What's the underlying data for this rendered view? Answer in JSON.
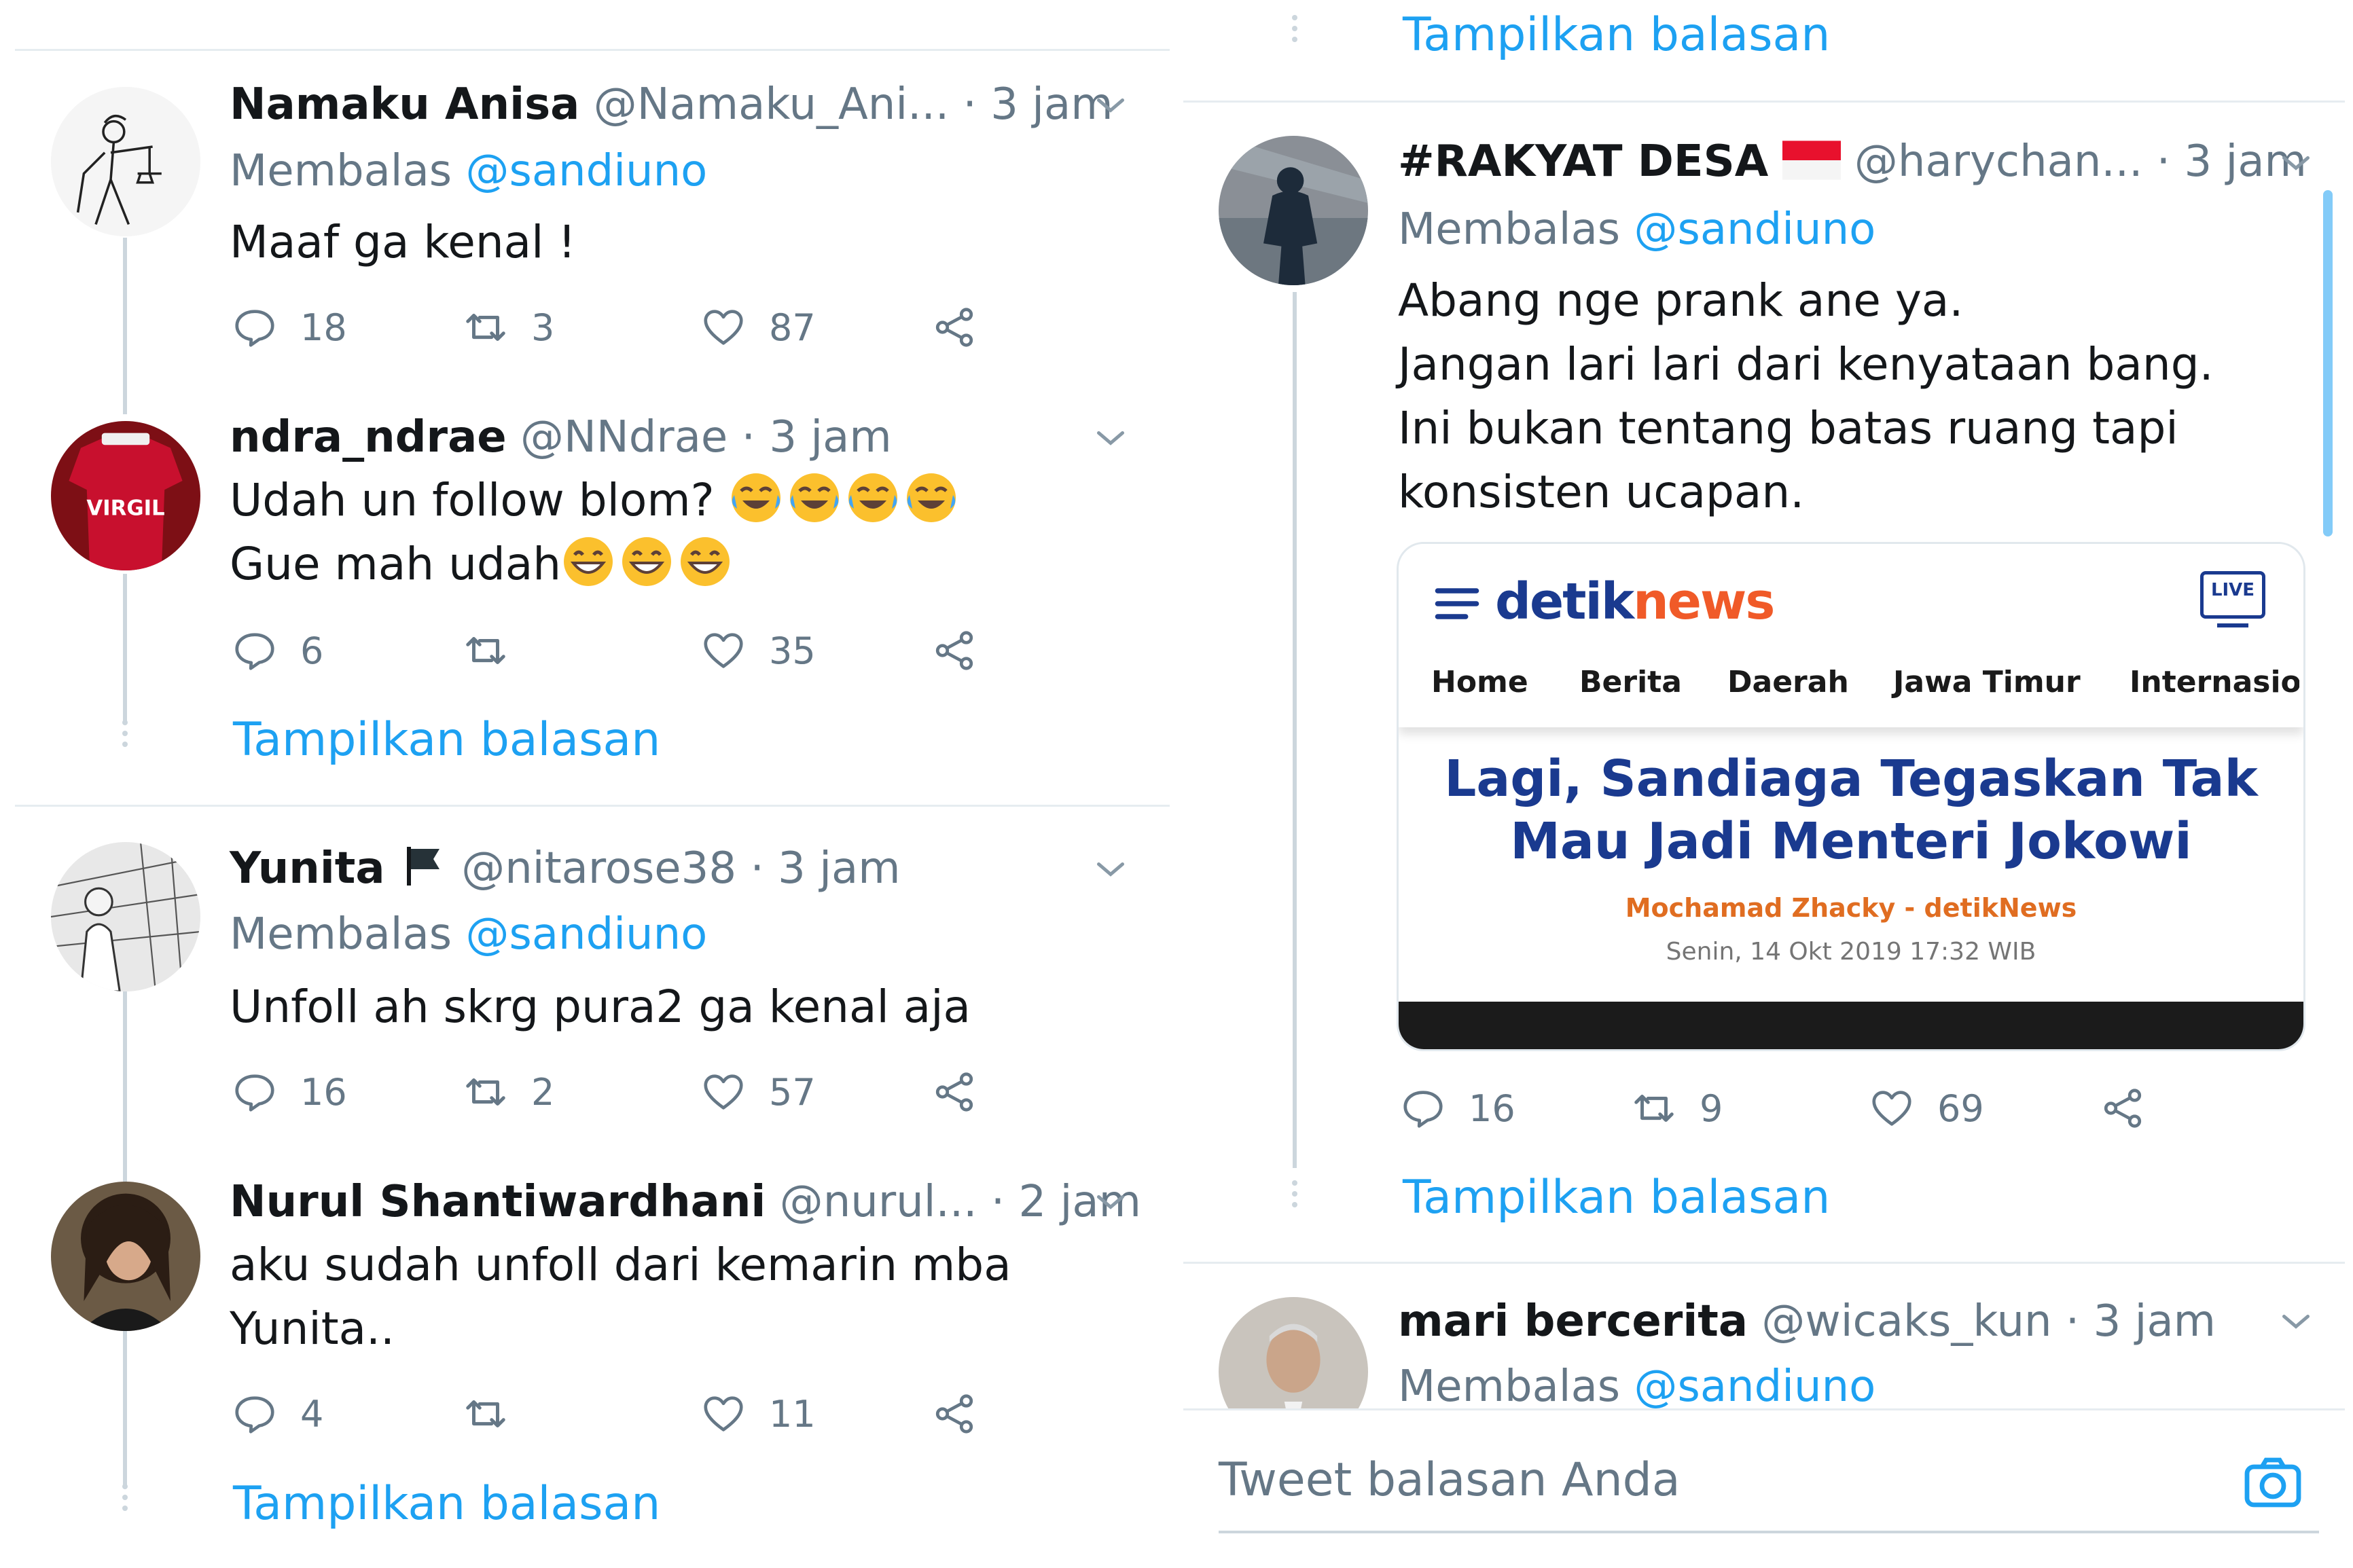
{
  "left": {
    "tweets": [
      {
        "name": "Namaku Anisa",
        "handle": "@Namaku_Ani...",
        "time": "· 3 jam",
        "reply_prefix": "Membalas",
        "reply_to": "@sandiuno",
        "text_lines": [
          "Maaf ga kenal !"
        ],
        "replies": "18",
        "retweets": "3",
        "likes": "87"
      },
      {
        "name": "ndra_ndrae",
        "handle": "@NNdrae",
        "time": "· 3 jam",
        "text_lines": [
          "Udah un follow blom?",
          "Gue mah udah"
        ],
        "replies": "6",
        "retweets": "",
        "likes": "35",
        "avatar_text": "VIRGIL"
      },
      {
        "name": "Yunita",
        "handle": "@nitarose38",
        "time": "· 3 jam",
        "reply_prefix": "Membalas",
        "reply_to": "@sandiuno",
        "text_lines": [
          "Unfoll ah skrg pura2 ga kenal aja"
        ],
        "replies": "16",
        "retweets": "2",
        "likes": "57"
      },
      {
        "name": "Nurul Shantiwardhani",
        "handle": "@nurul...",
        "time": "· 2 jam",
        "text_lines": [
          "aku sudah unfoll dari kemarin mba",
          "Yunita.."
        ],
        "replies": "4",
        "retweets": "",
        "likes": "11"
      }
    ],
    "show_replies_1": "Tampilkan balasan",
    "show_replies_2": "Tampilkan balasan"
  },
  "right": {
    "show_replies_top": "Tampilkan balasan",
    "tweet": {
      "name": "#RAKYAT DESA",
      "handle": "@harychan...",
      "time": "· 3 jam",
      "reply_prefix": "Membalas",
      "reply_to": "@sandiuno",
      "text_lines": [
        "Abang nge prank ane ya.",
        "Jangan lari lari dari kenyataan bang.",
        "Ini bukan tentang batas ruang tapi",
        "konsisten ucapan."
      ],
      "replies": "16",
      "retweets": "9",
      "likes": "69"
    },
    "card": {
      "brand_detik": "detik",
      "brand_news": "news",
      "live_label": "LIVE",
      "nav": [
        "Home",
        "Berita",
        "Daerah",
        "Jawa Timur",
        "Internasio"
      ],
      "headline_lines": [
        "Lagi, Sandiaga Tegaskan Tak",
        "Mau Jadi Menteri Jokowi"
      ],
      "byline": "Mochamad Zhacky - detikNews",
      "date": "Senin, 14 Okt 2019 17:32 WIB"
    },
    "show_replies_bottom": "Tampilkan balasan",
    "tweet2": {
      "name": "mari bercerita",
      "handle": "@wicaks_kun",
      "time": "· 3 jam",
      "reply_prefix": "Membalas",
      "reply_to": "@sandiuno"
    },
    "compose_placeholder": "Tweet balasan Anda"
  },
  "colors": {
    "accent": "#1da1f2",
    "muted": "#657786",
    "text": "#14171a",
    "divider": "#e6ecf0",
    "detik_blue": "#1a3a8f",
    "detik_orange": "#f05a28"
  }
}
